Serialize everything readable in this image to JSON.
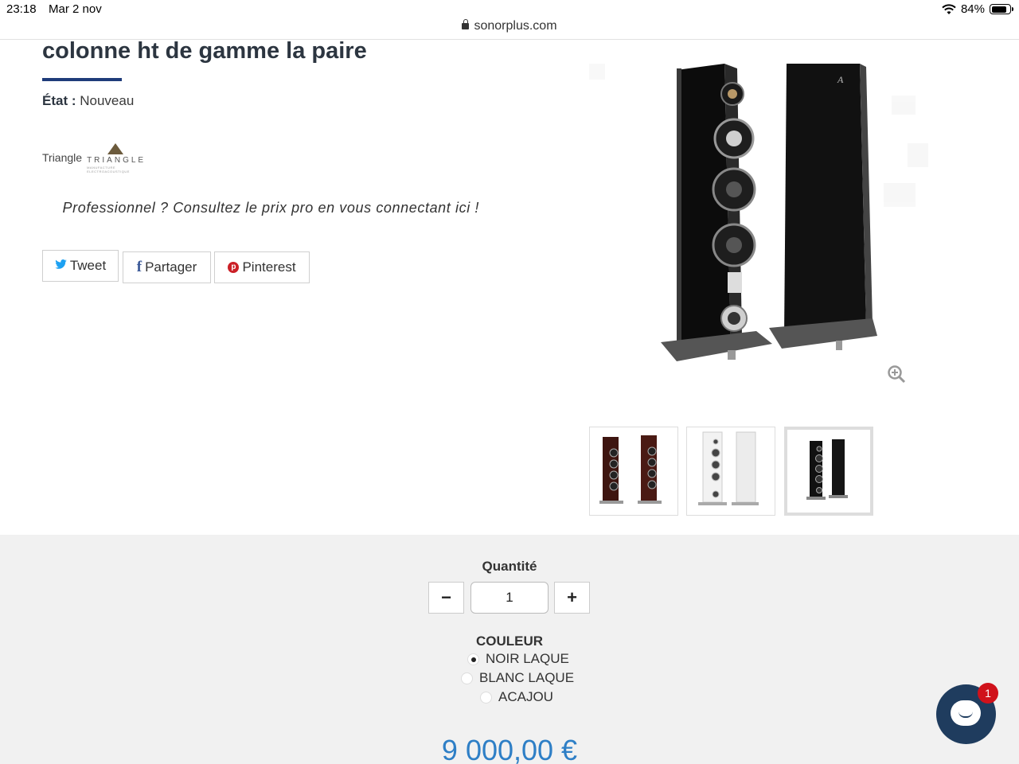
{
  "status_bar": {
    "time": "23:18",
    "date": "Mar 2 nov",
    "battery": "84%",
    "battery_level": 0.84
  },
  "browser": {
    "url": "sonorplus.com"
  },
  "product": {
    "title": "colonne ht de gamme la paire",
    "condition_label": "État :",
    "condition_value": "Nouveau",
    "brand": "Triangle",
    "brand_logo_text": "TRIANGLE",
    "brand_logo_subtext": "MANUFACTURE ELECTROACOUSTIQUE",
    "pro_notice": "Professionnel ? Consultez le prix pro en vous connectant ici !"
  },
  "share": {
    "tweet": "Tweet",
    "facebook": "Partager",
    "pinterest": "Pinterest"
  },
  "thumbnails": [
    {
      "color": "acajou",
      "hex": "#4a1a14"
    },
    {
      "color": "blanc",
      "hex": "#e8e8e8"
    },
    {
      "color": "noir",
      "hex": "#111111",
      "selected": true
    }
  ],
  "purchase": {
    "quantity_label": "Quantité",
    "quantity_value": "1",
    "color_label": "COULEUR",
    "options": [
      {
        "label": "NOIR LAQUE",
        "selected": true
      },
      {
        "label": "BLANC LAQUE",
        "selected": false
      },
      {
        "label": "ACAJOU",
        "selected": false
      }
    ],
    "price": "9 000,00 €"
  },
  "chat": {
    "badge": "1"
  }
}
